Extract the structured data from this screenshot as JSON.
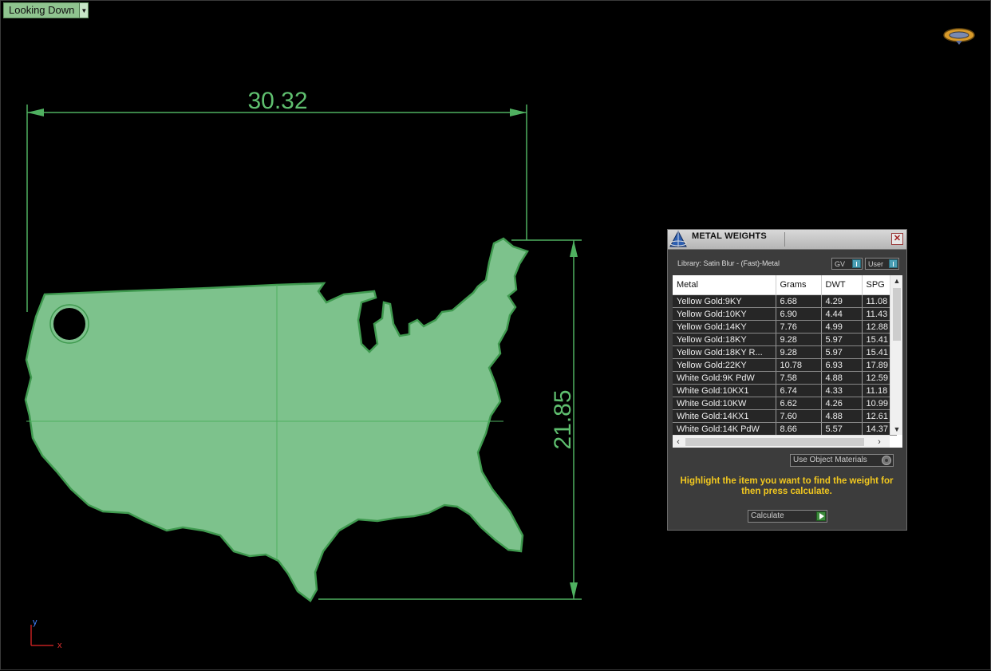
{
  "viewport": {
    "view_label": "Looking Down",
    "axis_x_label": "x",
    "axis_y_label": "y"
  },
  "dimensions": {
    "width_value": "30.32",
    "height_value": "21.85"
  },
  "colors": {
    "shape_fill": "#7dc28c",
    "dimension_line": "#4fb060",
    "panel_bg": "#3c3c3c",
    "hint_text": "#f2c81f",
    "toggle_indicator": "#4a9fb5"
  },
  "metal_weights_panel": {
    "title": "METAL WEIGHTS",
    "library": "Library: Satin Blur - (Fast)-Metal",
    "toggle_gv": "GV",
    "toggle_user": "User",
    "columns": [
      "Metal",
      "Grams",
      "DWT",
      "SPG"
    ],
    "rows": [
      [
        "Yellow Gold:9KY",
        "6.68",
        "4.29",
        "11.08"
      ],
      [
        "Yellow Gold:10KY",
        "6.90",
        "4.44",
        "11.43"
      ],
      [
        "Yellow Gold:14KY",
        "7.76",
        "4.99",
        "12.88"
      ],
      [
        "Yellow Gold:18KY",
        "9.28",
        "5.97",
        "15.41"
      ],
      [
        "Yellow Gold:18KY R...",
        "9.28",
        "5.97",
        "15.41"
      ],
      [
        "Yellow Gold:22KY",
        "10.78",
        "6.93",
        "17.89"
      ],
      [
        "White Gold:9K PdW",
        "7.58",
        "4.88",
        "12.59"
      ],
      [
        "White Gold:10KX1",
        "6.74",
        "4.33",
        "11.18"
      ],
      [
        "White Gold:10KW",
        "6.62",
        "4.26",
        "10.99"
      ],
      [
        "White Gold:14KX1",
        "7.60",
        "4.88",
        "12.61"
      ],
      [
        "White Gold:14K PdW",
        "8.66",
        "5.57",
        "14.37"
      ]
    ],
    "use_object_materials": "Use Object Materials",
    "hint": "Highlight the item you want to find the weight for then press calculate.",
    "calculate_label": "Calculate"
  }
}
